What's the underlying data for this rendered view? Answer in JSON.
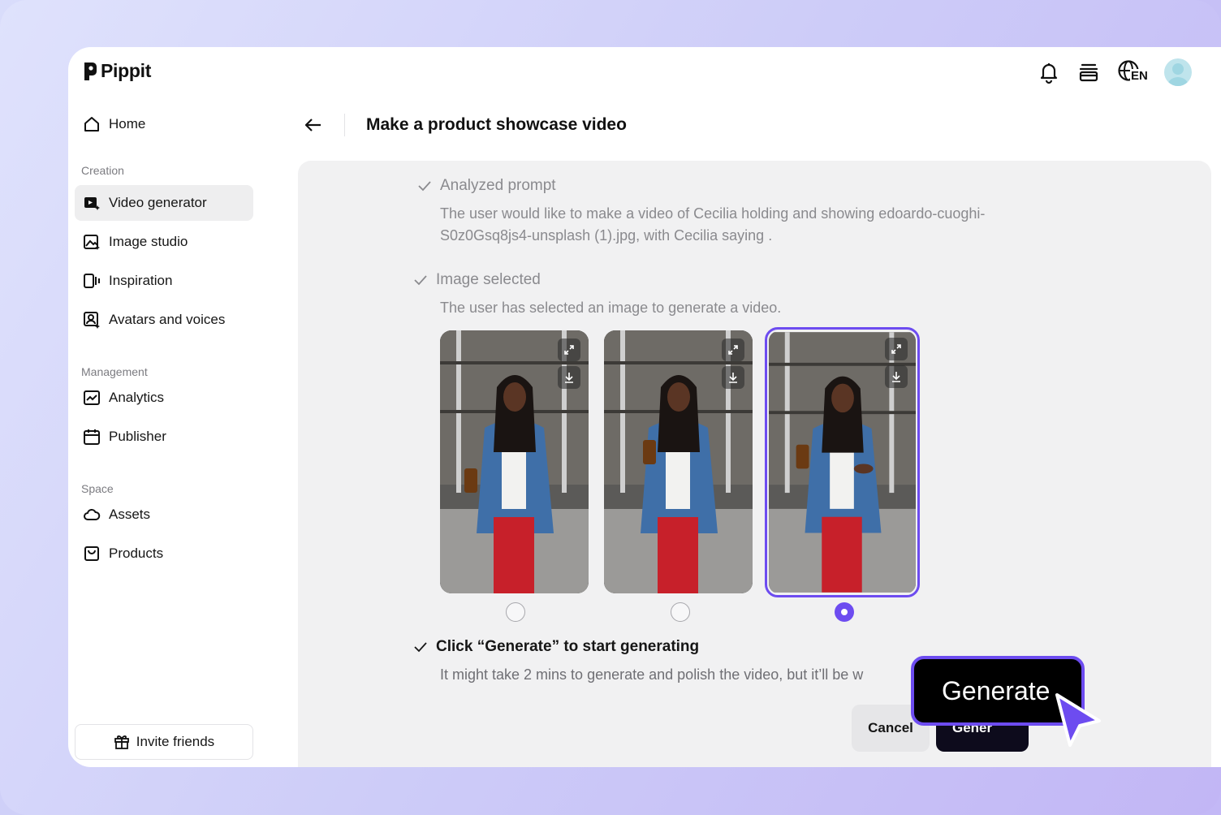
{
  "app": {
    "name": "Pippit"
  },
  "colors": {
    "accent": "#6d4cf0",
    "selected_nav_bg": "#eeeeef",
    "panel_bg": "#f1f1f2"
  },
  "top_icons": [
    "bell-icon",
    "layers-icon",
    "globe-language-icon",
    "user-avatar"
  ],
  "language": "EN",
  "sidebar": {
    "home": "Home",
    "sections": [
      {
        "label": "Creation",
        "items": [
          "Video generator",
          "Image studio",
          "Inspiration",
          "Avatars and voices"
        ]
      },
      {
        "label": "Management",
        "items": [
          "Analytics",
          "Publisher"
        ]
      },
      {
        "label": "Space",
        "items": [
          "Assets",
          "Products"
        ]
      }
    ],
    "active_item": "Video generator",
    "invite": "Invite friends"
  },
  "header": {
    "title": "Make a product showcase video"
  },
  "steps": {
    "analyzed": {
      "title": "Analyzed prompt",
      "desc_line1": "The user would like to make a video of Cecilia holding and showing edoardo-cuoghi-",
      "desc_line2": "S0z0Gsq8js4-unsplash (1).jpg, with Cecilia saying ."
    },
    "image": {
      "title": "Image selected",
      "desc": "The user has selected an image to generate a video."
    },
    "generate": {
      "title": "Click “Generate” to start generating",
      "desc": "It might take 2 mins to generate and polish the video, but it’ll be w"
    }
  },
  "images": {
    "count": 3,
    "selected_index": 2
  },
  "buttons": {
    "cancel": "Cancel",
    "generate_small": "Gener",
    "generate_big": "Generate"
  }
}
